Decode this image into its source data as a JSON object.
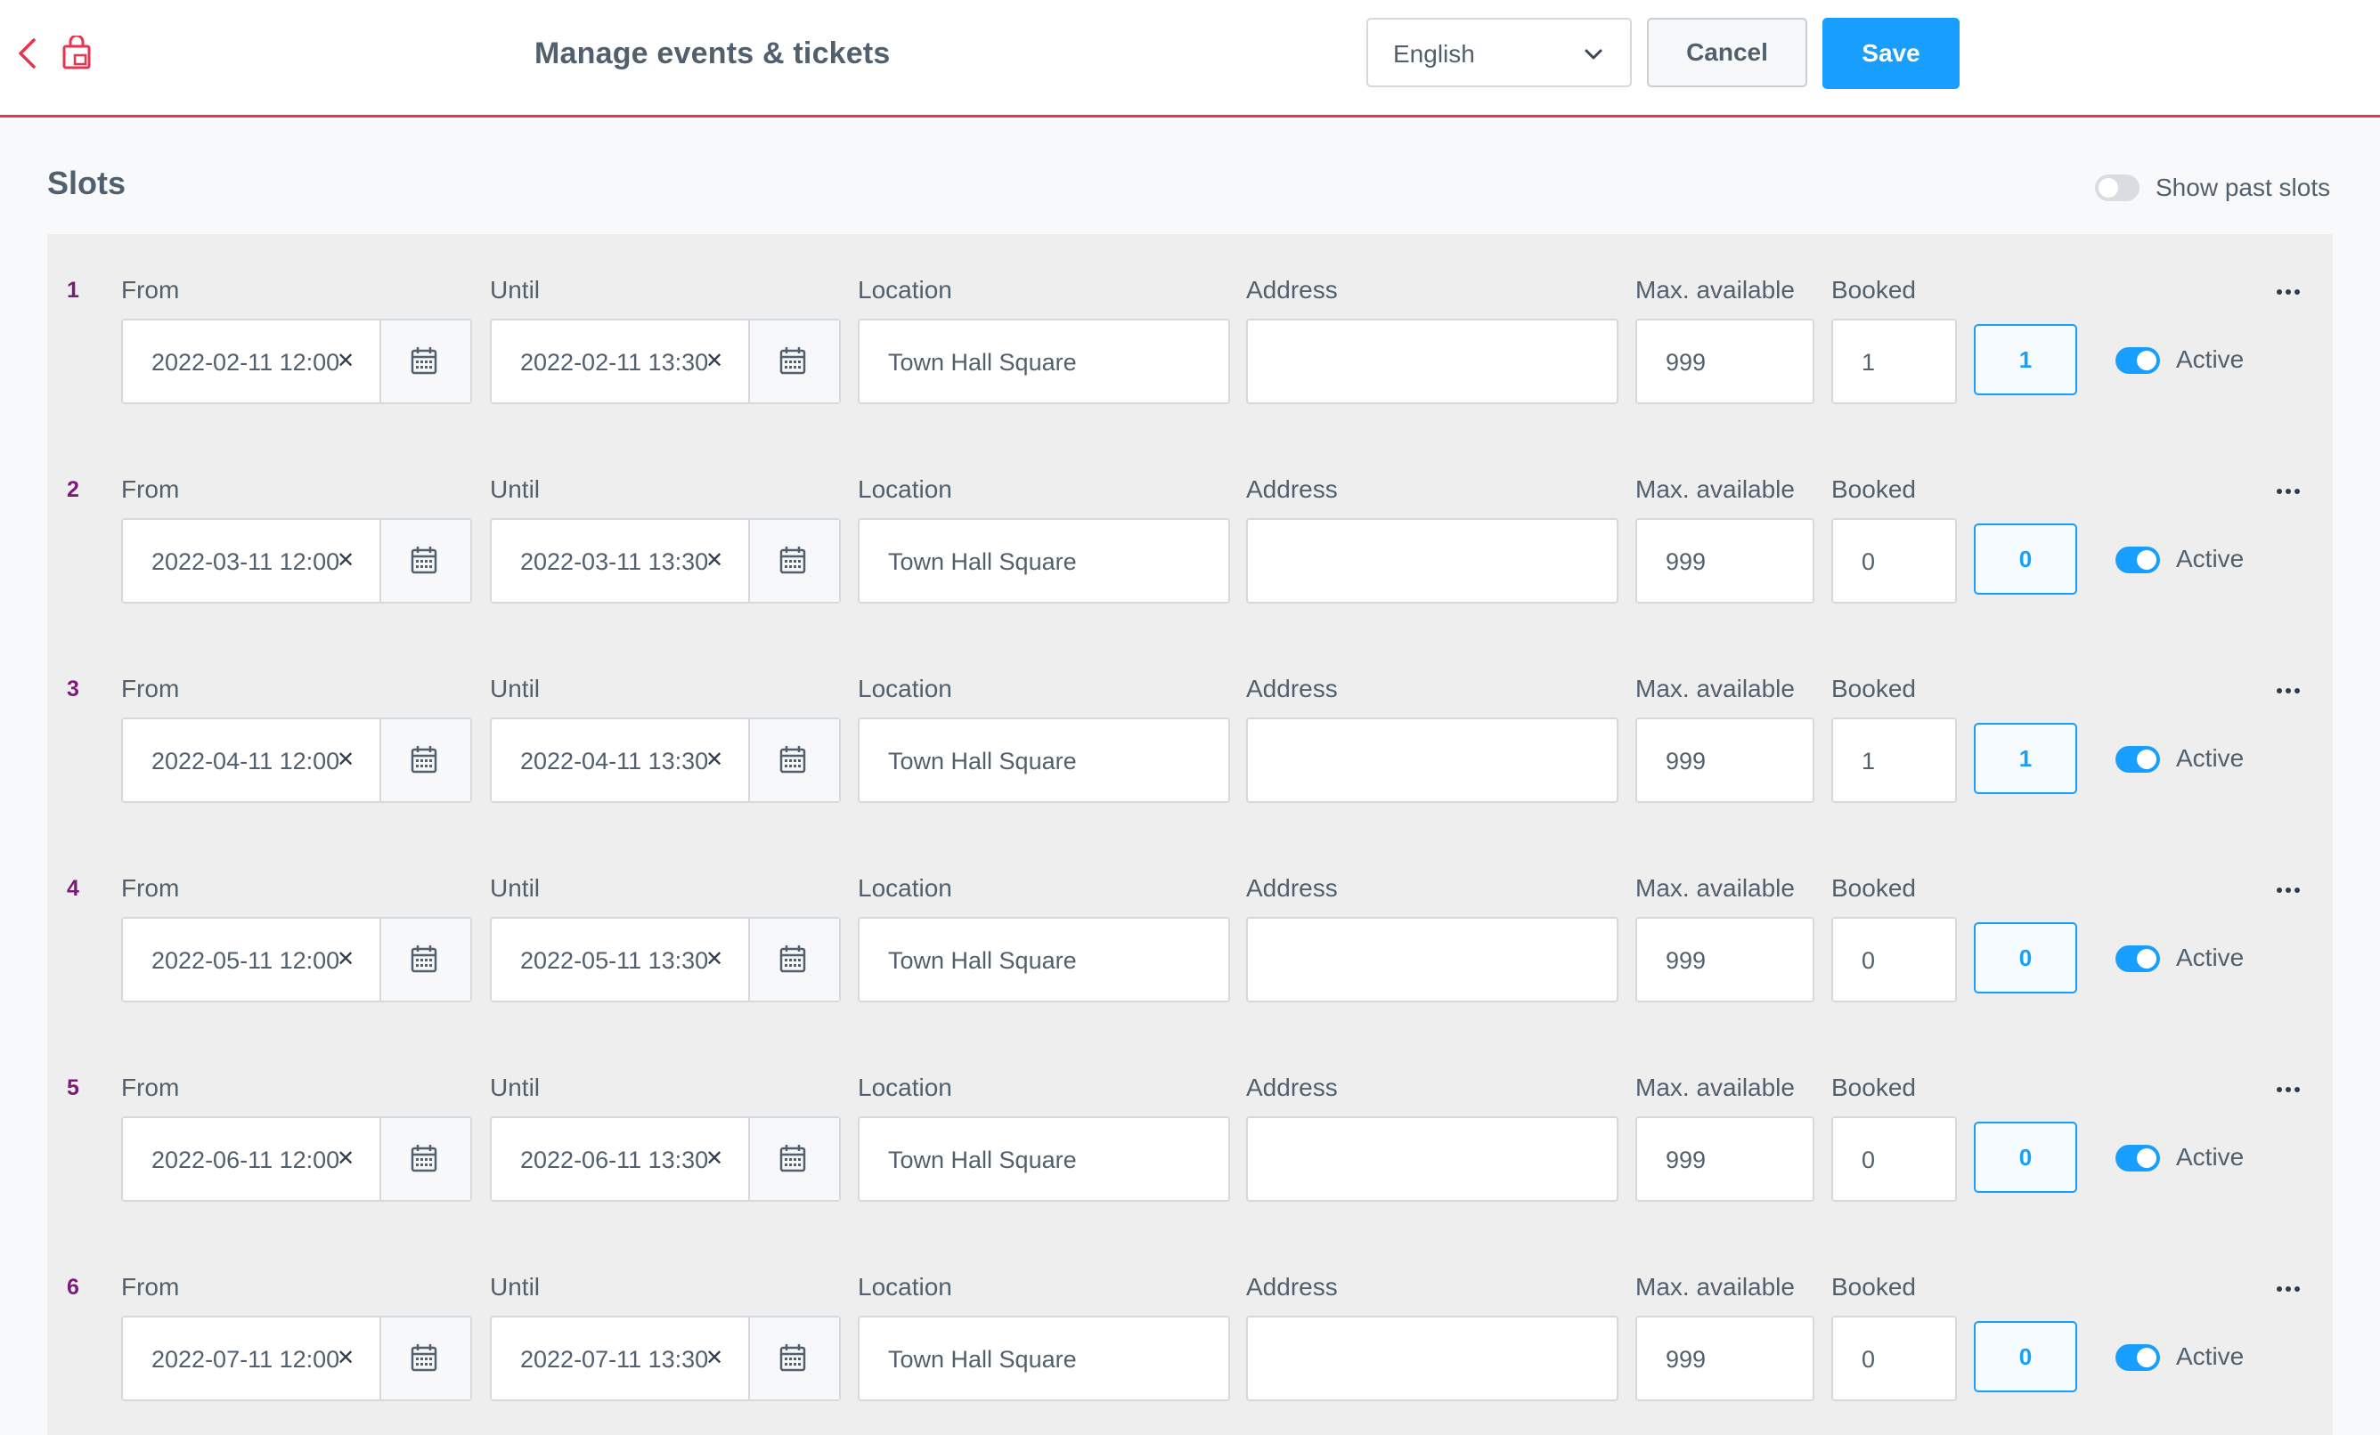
{
  "header": {
    "title": "Manage events & tickets",
    "language": "English",
    "cancel_label": "Cancel",
    "save_label": "Save",
    "accent_color": "#e8344e",
    "primary_color": "#189eff"
  },
  "slots_section": {
    "title": "Slots",
    "show_past_label": "Show past slots",
    "show_past_enabled": false
  },
  "labels": {
    "from": "From",
    "until": "Until",
    "location": "Location",
    "address": "Address",
    "max_available": "Max. available",
    "booked": "Booked",
    "active": "Active"
  },
  "slots": [
    {
      "num": "1",
      "from": "2022-02-11 12:00",
      "until": "2022-02-11 13:30",
      "location": "Town Hall Square",
      "address": "",
      "max_available": "999",
      "booked": "1",
      "booked_count": "1",
      "active": true
    },
    {
      "num": "2",
      "from": "2022-03-11 12:00",
      "until": "2022-03-11 13:30",
      "location": "Town Hall Square",
      "address": "",
      "max_available": "999",
      "booked": "0",
      "booked_count": "0",
      "active": true
    },
    {
      "num": "3",
      "from": "2022-04-11 12:00",
      "until": "2022-04-11 13:30",
      "location": "Town Hall Square",
      "address": "",
      "max_available": "999",
      "booked": "1",
      "booked_count": "1",
      "active": true
    },
    {
      "num": "4",
      "from": "2022-05-11 12:00",
      "until": "2022-05-11 13:30",
      "location": "Town Hall Square",
      "address": "",
      "max_available": "999",
      "booked": "0",
      "booked_count": "0",
      "active": true
    },
    {
      "num": "5",
      "from": "2022-06-11 12:00",
      "until": "2022-06-11 13:30",
      "location": "Town Hall Square",
      "address": "",
      "max_available": "999",
      "booked": "0",
      "booked_count": "0",
      "active": true
    },
    {
      "num": "6",
      "from": "2022-07-11 12:00",
      "until": "2022-07-11 13:30",
      "location": "Town Hall Square",
      "address": "",
      "max_available": "999",
      "booked": "0",
      "booked_count": "0",
      "active": true
    }
  ],
  "icons": {
    "back": "chevron-left-icon",
    "external": "open-in-shop-icon",
    "dropdown": "chevron-down-icon",
    "clear": "close-icon",
    "calendar": "calendar-icon",
    "more": "more-dots-icon"
  }
}
